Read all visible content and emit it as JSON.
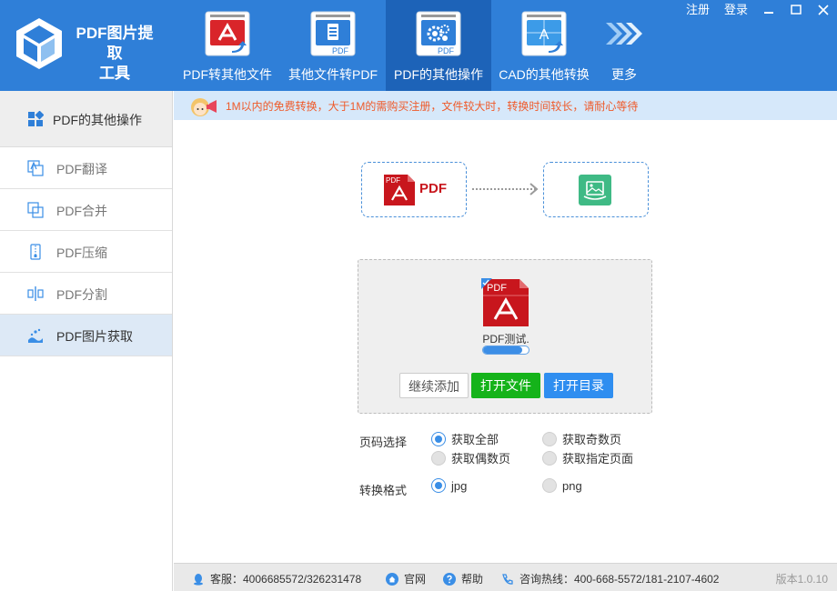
{
  "app": {
    "title_line1": "PDF图片提取",
    "title_line2": "工具"
  },
  "window_controls": {
    "register": "注册",
    "login": "登录"
  },
  "nav": [
    {
      "label": "PDF转其他文件"
    },
    {
      "label": "其他文件转PDF"
    },
    {
      "label": "PDF的其他操作",
      "active": true
    },
    {
      "label": "CAD的其他转换"
    },
    {
      "label": "更多"
    }
  ],
  "nav_icon_text": {
    "pdf_tag": "PDF",
    "cad_glyph": "A"
  },
  "sidebar": {
    "header": "PDF的其他操作",
    "items": [
      {
        "label": "PDF翻译"
      },
      {
        "label": "PDF合并"
      },
      {
        "label": "PDF压缩"
      },
      {
        "label": "PDF分割"
      },
      {
        "label": "PDF图片获取",
        "active": true
      }
    ]
  },
  "notice": "1M以内的免费转换，大于1M的需购买注册，文件较大时，转换时间较长，请耐心等待",
  "flow": {
    "source_label": "PDF",
    "source_badge": "PDF"
  },
  "file": {
    "name": "PDF测试.",
    "badge": "PDF",
    "progress": 0.85
  },
  "buttons": {
    "add": "继续添加",
    "open_file": "打开文件",
    "open_dir": "打开目录"
  },
  "page_select": {
    "label": "页码选择",
    "options": [
      {
        "label": "获取全部",
        "checked": true
      },
      {
        "label": "获取奇数页",
        "checked": false
      },
      {
        "label": "获取偶数页",
        "checked": false
      },
      {
        "label": "获取指定页面",
        "checked": false
      }
    ]
  },
  "format_select": {
    "label": "转换格式",
    "options": [
      {
        "label": "jpg",
        "checked": true
      },
      {
        "label": "png",
        "checked": false
      }
    ]
  },
  "footer": {
    "service": "客服：4006685572/326231478",
    "website": "官网",
    "help": "帮助",
    "hotline": "咨询热线：400-668-5572/181-2107-4602",
    "version": "版本1.0.10"
  },
  "colors": {
    "header": "#2f7fd8",
    "header_active": "#1d63b8",
    "accent": "#3a8ee6",
    "pdf_red": "#c8161d",
    "open_green": "#15b31a",
    "notice_text": "#ef5a2a"
  }
}
